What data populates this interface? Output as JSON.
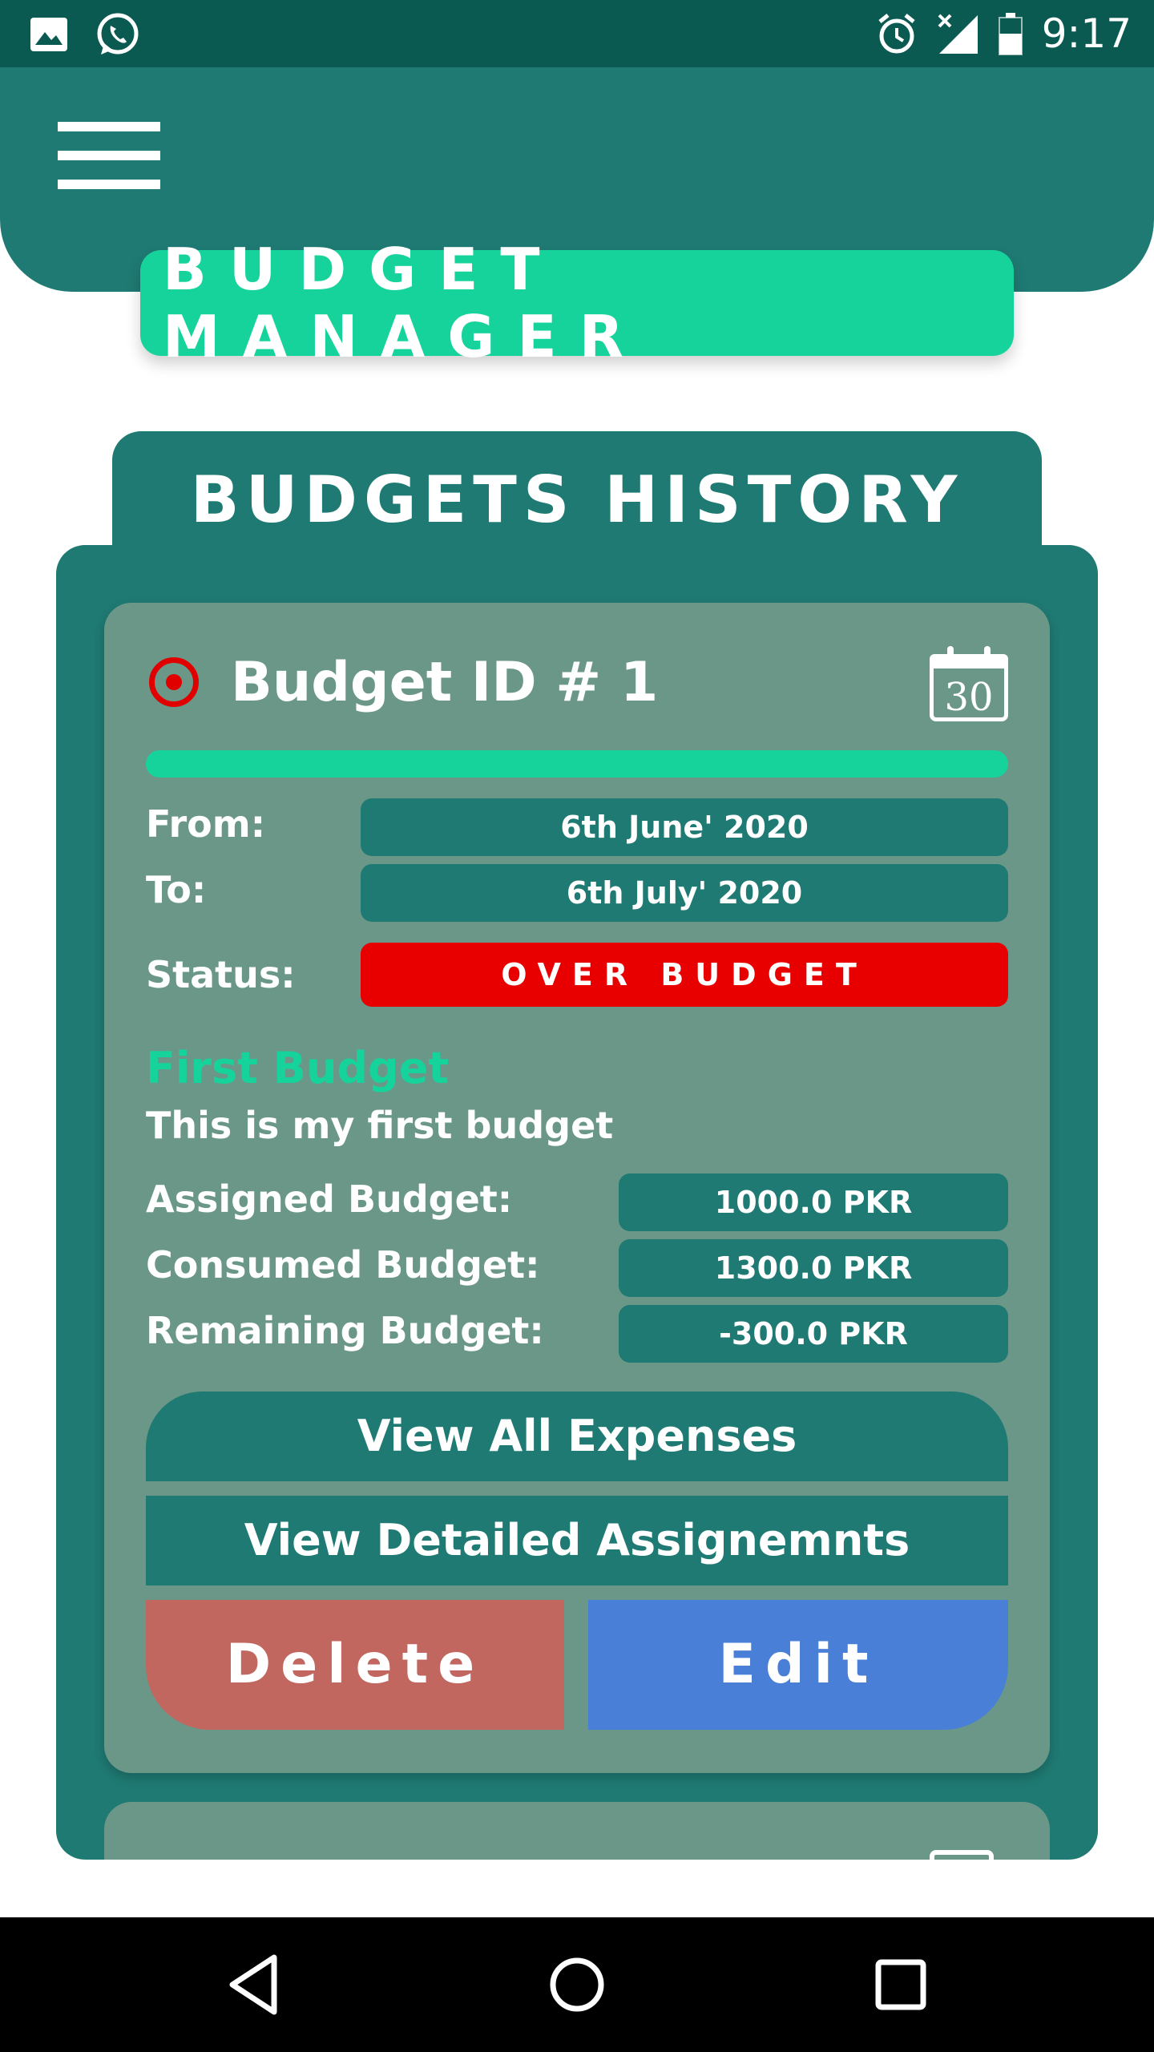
{
  "status_bar": {
    "time": "9:17",
    "icons": [
      "image-icon",
      "whatsapp-icon",
      "alarm-icon",
      "signal-icon",
      "battery-icon"
    ]
  },
  "header": {
    "menu_icon": "hamburger-menu-icon",
    "app_title": "BUDGET MANAGER"
  },
  "history": {
    "title": "BUDGETS HISTORY"
  },
  "budget_card": {
    "title": "Budget ID # 1",
    "calendar_day": "30",
    "from_label": "From:",
    "from_value": "6th June' 2020",
    "to_label": "To:",
    "to_value": "6th July' 2020",
    "status_label": "Status:",
    "status_value": "OVER BUDGET",
    "name": "First Budget",
    "description": "This is my first budget",
    "assigned_label": "Assigned Budget:",
    "assigned_value": "1000.0 PKR",
    "consumed_label": "Consumed Budget:",
    "consumed_value": "1300.0 PKR",
    "remaining_label": "Remaining Budget:",
    "remaining_value": "-300.0 PKR",
    "view_expenses_label": "View All Expenses",
    "view_assignments_label": "View Detailed Assignemnts",
    "delete_label": "Delete",
    "edit_label": "Edit"
  },
  "colors": {
    "primary": "#1f7a73",
    "accent": "#16d39c",
    "card": "#6a9787",
    "over_budget": "#e80000",
    "delete": "#c26660",
    "edit": "#4a7fd8"
  },
  "nav_bar": {
    "icons": [
      "back-icon",
      "home-icon",
      "recents-icon"
    ]
  }
}
